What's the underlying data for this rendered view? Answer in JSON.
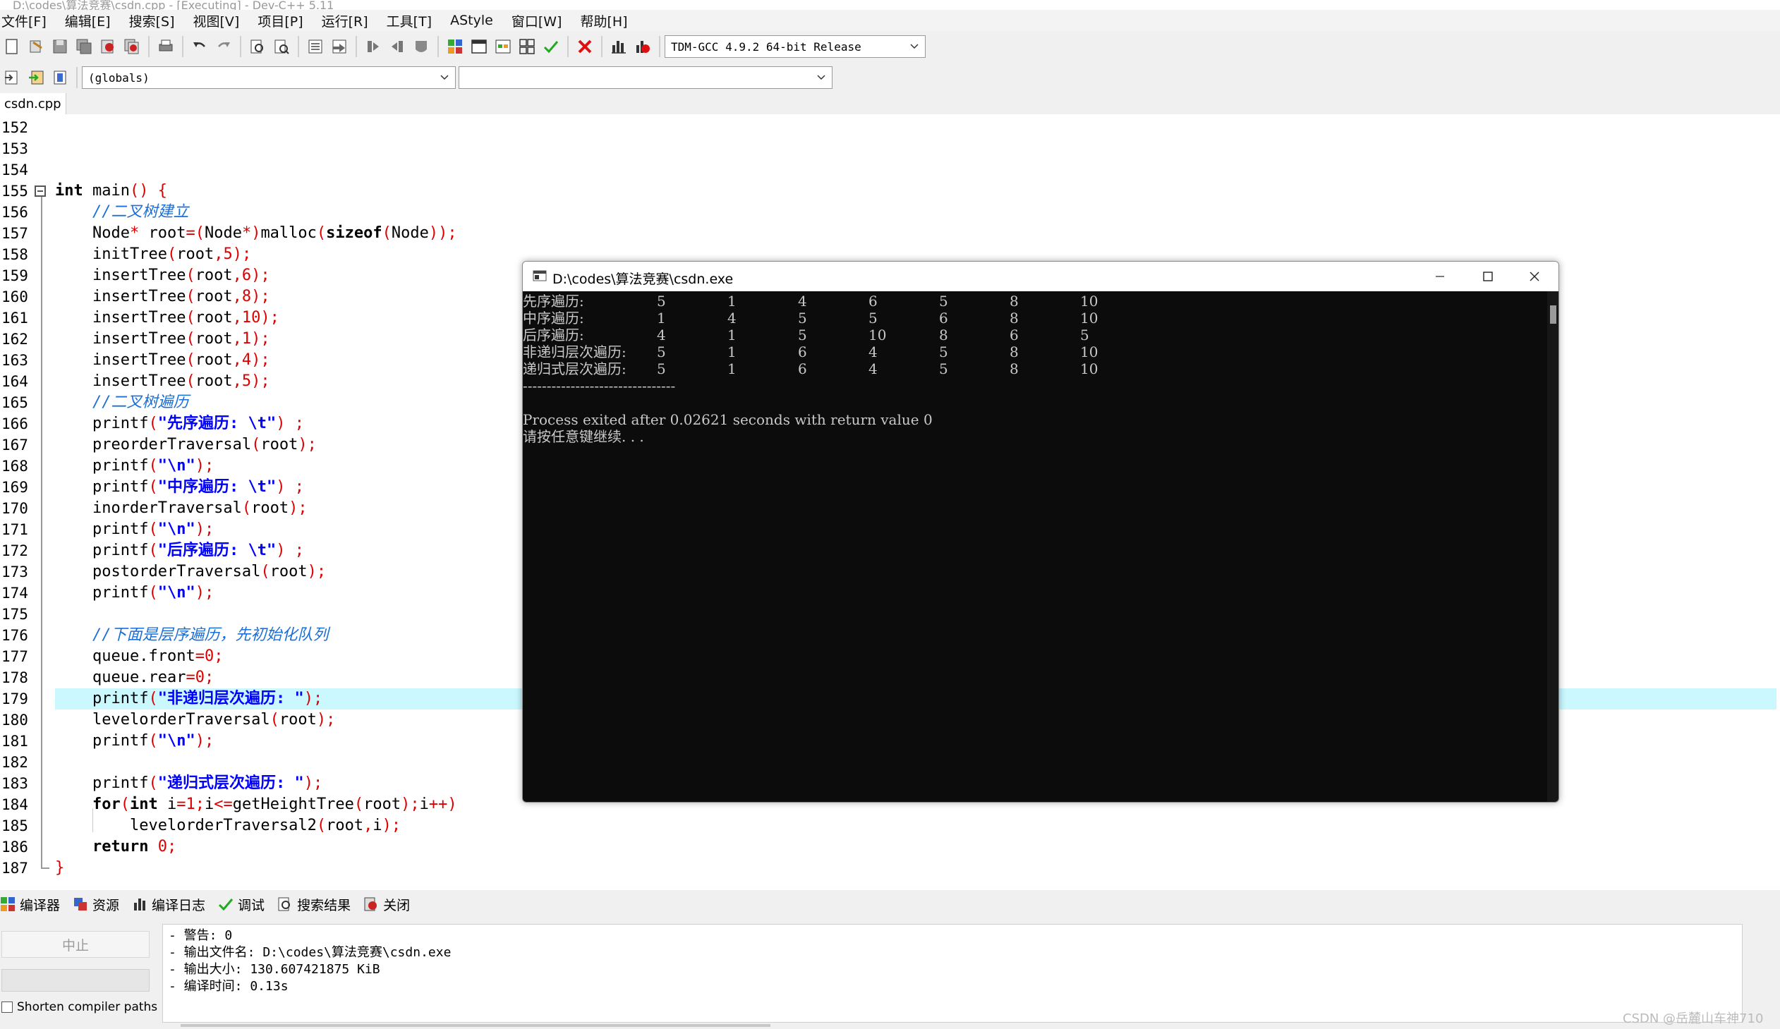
{
  "window": {
    "title": "D:\\codes\\算法竞赛\\csdn.cpp - [Executing] - Dev-C++ 5.11"
  },
  "menu": [
    "文件[F]",
    "编辑[E]",
    "搜索[S]",
    "视图[V]",
    "项目[P]",
    "运行[R]",
    "工具[T]",
    "AStyle",
    "窗口[W]",
    "帮助[H]"
  ],
  "toolbar": {
    "compiler": "TDM-GCC 4.9.2 64-bit Release",
    "scope": "(globals)",
    "symbol": ""
  },
  "tab": {
    "file": "csdn.cpp"
  },
  "editor": {
    "line_numbers": [
      "152",
      "153",
      "154",
      "155",
      "156",
      "157",
      "158",
      "159",
      "160",
      "161",
      "162",
      "163",
      "164",
      "165",
      "166",
      "167",
      "168",
      "169",
      "170",
      "171",
      "172",
      "173",
      "174",
      "175",
      "176",
      "177",
      "178",
      "179",
      "180",
      "181",
      "182",
      "183",
      "184",
      "185",
      "186",
      "187"
    ],
    "code": [
      "",
      "",
      "",
      "int main() {",
      "    //二叉树建立",
      "    Node* root=(Node*)malloc(sizeof(Node));",
      "    initTree(root,5);",
      "    insertTree(root,6);",
      "    insertTree(root,8);",
      "    insertTree(root,10);",
      "    insertTree(root,1);",
      "    insertTree(root,4);",
      "    insertTree(root,5);",
      "    //二叉树遍历",
      "    printf(\"先序遍历: \\t\") ;",
      "    preorderTraversal(root);",
      "    printf(\"\\n\");",
      "    printf(\"中序遍历: \\t\") ;",
      "    inorderTraversal(root);",
      "    printf(\"\\n\");",
      "    printf(\"后序遍历: \\t\") ;",
      "    postorderTraversal(root);",
      "    printf(\"\\n\");",
      "",
      "    //下面是层序遍历，先初始化队列",
      "    queue.front=0;",
      "    queue.rear=0;",
      "    printf(\"非递归层次遍历: \");",
      "    levelorderTraversal(root);",
      "    printf(\"\\n\");",
      "",
      "    printf(\"递归式层次遍历: \");",
      "    for(int i=1;i<=getHeightTree(root);i++)",
      "        levelorderTraversal2(root,i);",
      "    return 0;",
      "}"
    ]
  },
  "console": {
    "title": "D:\\codes\\算法竞赛\\csdn.exe",
    "rows": [
      {
        "label": "先序遍历:",
        "values": [
          "5",
          "1",
          "4",
          "6",
          "5",
          "8",
          "10"
        ]
      },
      {
        "label": "中序遍历:",
        "values": [
          "1",
          "4",
          "5",
          "5",
          "6",
          "8",
          "10"
        ]
      },
      {
        "label": "后序遍历:",
        "values": [
          "4",
          "1",
          "5",
          "10",
          "8",
          "6",
          "5"
        ]
      },
      {
        "label": "非递归层次遍历:",
        "values": [
          "5",
          "1",
          "6",
          "4",
          "5",
          "8",
          "10"
        ]
      },
      {
        "label": "递归式层次遍历:",
        "values": [
          "5",
          "1",
          "6",
          "4",
          "5",
          "8",
          "10"
        ]
      }
    ],
    "separator": "--------------------------------",
    "exit_line": "Process exited after 0.02621 seconds with return value 0",
    "continue_line": "请按任意键继续. . ."
  },
  "bottom_tabs": [
    "编译器",
    "资源",
    "编译日志",
    "调试",
    "搜索结果",
    "关闭"
  ],
  "compile_log": {
    "abort_label": "中止",
    "shorten_label": "Shorten compiler paths",
    "lines": [
      "- 警告: 0",
      "- 输出文件名: D:\\codes\\算法竞赛\\csdn.exe",
      "- 输出大小: 130.607421875 KiB",
      "- 编译时间: 0.13s"
    ]
  },
  "watermark": "CSDN @岳麓山车神710",
  "colors": {
    "highlight_line": "#cbf8ff",
    "keyword_red": "#d00000",
    "string_blue": "#0000ff",
    "comment_blue": "#1a6fd8",
    "console_bg": "#0c0c0c"
  }
}
